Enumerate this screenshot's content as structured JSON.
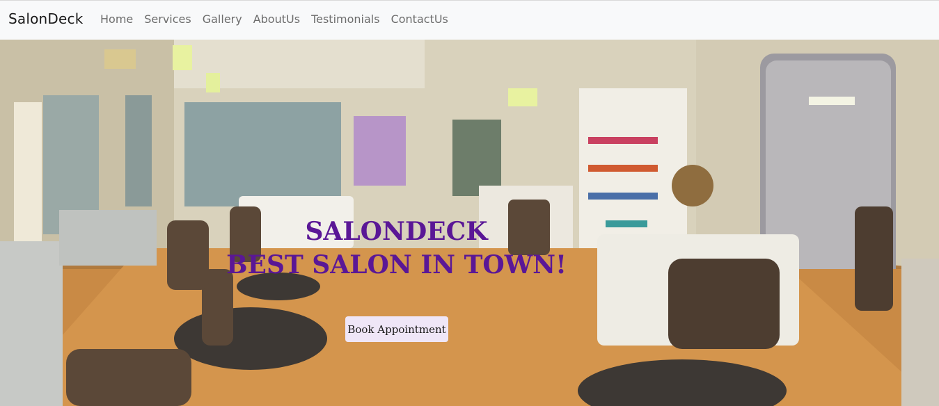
{
  "navbar": {
    "brand": "SalonDeck",
    "links": [
      "Home",
      "Services",
      "Gallery",
      "AboutUs",
      "Testimonials",
      "ContactUs"
    ]
  },
  "hero": {
    "title_line1": "SALONDECK",
    "title_line2": "BEST SALON IN TOWN!",
    "cta_label": "Book Appointment",
    "image_subject": "salon interior with styling chairs and mirrors"
  },
  "colors": {
    "title": "#5a1796",
    "cta_background": "#efe6f7",
    "navbar_background": "#f8f9fa"
  }
}
